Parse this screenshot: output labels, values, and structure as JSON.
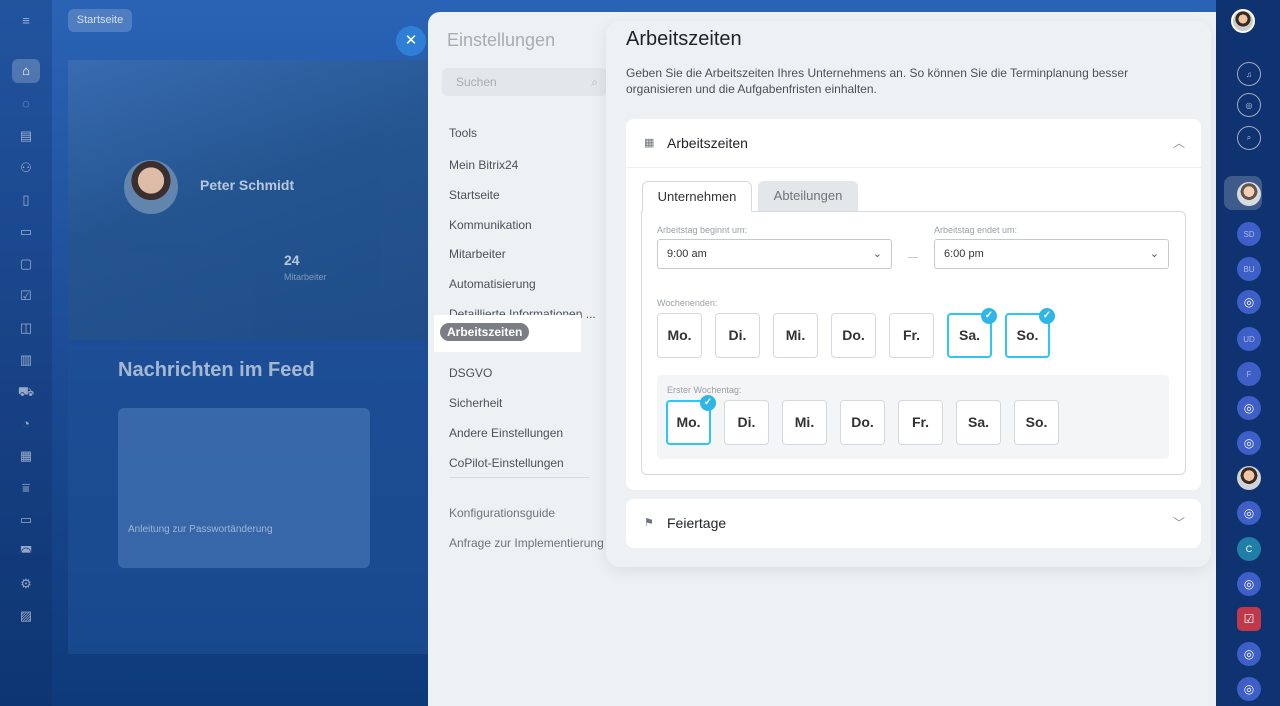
{
  "background": {
    "top_chip": "Startseite",
    "profile": {
      "name": "Peter Schmidt",
      "count": "24",
      "count_label": "Mitarbeiter"
    },
    "feed": {
      "title": "Nachrichten im Feed",
      "card_title": "Anleitung zur Passwortänderung"
    }
  },
  "settings": {
    "title": "Einstellungen",
    "search_placeholder": "Suchen",
    "nav": [
      {
        "label": "Tools"
      },
      {
        "label": "Mein Bitrix24"
      },
      {
        "label": "Startseite"
      },
      {
        "label": "Kommunikation"
      },
      {
        "label": "Mitarbeiter"
      },
      {
        "label": "Automatisierung"
      },
      {
        "label": "Detaillierte Informationen ..."
      },
      {
        "label": "Arbeitszeiten",
        "active": true
      },
      {
        "label": "DSGVO"
      },
      {
        "label": "Sicherheit"
      },
      {
        "label": "Andere Einstellungen"
      },
      {
        "label": "CoPilot-Einstellungen"
      }
    ],
    "nav_extra": [
      {
        "label": "Konfigurationsguide"
      },
      {
        "label": "Anfrage zur Implementierung"
      }
    ]
  },
  "panel": {
    "title": "Arbeitszeiten",
    "description": "Geben Sie die Arbeitszeiten Ihres Unternehmens an. So können Sie die Terminplanung besser organisieren und die Aufgabenfristen einhalten.",
    "section": {
      "title": "Arbeitszeiten",
      "icon": "calendar-icon",
      "tabs": [
        "Unternehmen",
        "Abteilungen"
      ],
      "start_label": "Arbeitstag beginnt um:",
      "start_value": "9:00 am",
      "end_label": "Arbeitstag endet um:",
      "end_value": "6:00 pm",
      "weekends_label": "Wochenenden:",
      "weekend_days": [
        {
          "label": "Mo.",
          "selected": false
        },
        {
          "label": "Di.",
          "selected": false
        },
        {
          "label": "Mi.",
          "selected": false
        },
        {
          "label": "Do.",
          "selected": false
        },
        {
          "label": "Fr.",
          "selected": false
        },
        {
          "label": "Sa.",
          "selected": true
        },
        {
          "label": "So.",
          "selected": true
        }
      ],
      "first_day_label": "Erster Wochentag:",
      "first_days": [
        {
          "label": "Mo.",
          "selected": true
        },
        {
          "label": "Di.",
          "selected": false
        },
        {
          "label": "Mi.",
          "selected": false
        },
        {
          "label": "Do.",
          "selected": false
        },
        {
          "label": "Fr.",
          "selected": false
        },
        {
          "label": "Sa.",
          "selected": false
        },
        {
          "label": "So.",
          "selected": false
        }
      ]
    },
    "holidays": {
      "title": "Feiertage",
      "icon": "flag-icon"
    }
  },
  "colors": {
    "accent": "#2fc6f6",
    "check": "#2fb5e8",
    "active_pill": "#7b7f85",
    "close_button": "#2f7fd6"
  }
}
